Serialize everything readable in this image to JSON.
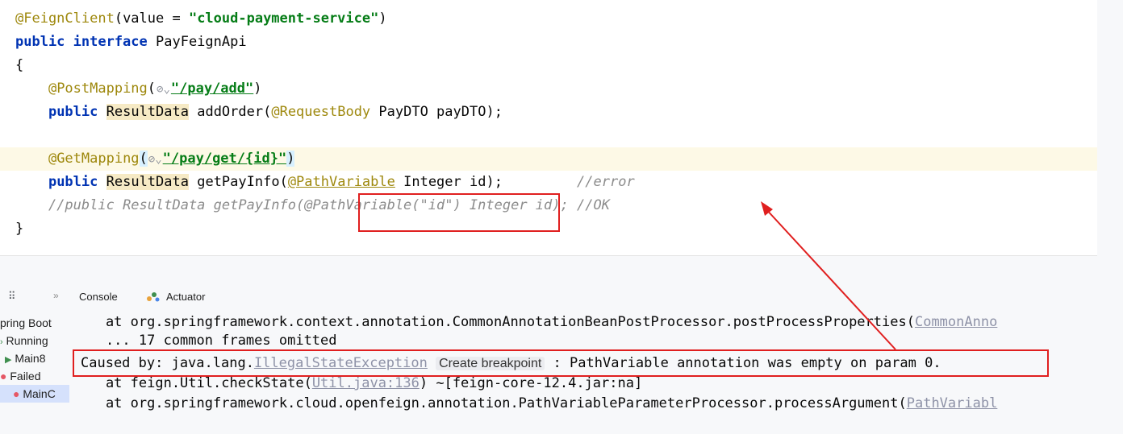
{
  "code": {
    "line1": {
      "ann": "@FeignClient",
      "open": "(value = ",
      "str": "\"cloud-payment-service\"",
      "close": ")"
    },
    "line2": {
      "kw": "public interface",
      "rest": " PayFeignApi"
    },
    "line3": {
      "text": "{"
    },
    "line4": {
      "ann": "@PostMapping",
      "open": "(",
      "inlay": "⊘⌄",
      "str": "\"/pay/add\"",
      "close": ")"
    },
    "line5": {
      "kw": "public",
      "type": "ResultData",
      "mid": " addOrder(",
      "ann": "@RequestBody",
      "rest": " PayDTO payDTO);"
    },
    "line7": {
      "ann": "@GetMapping",
      "open": "(",
      "inlay": "⊘⌄",
      "str": "\"/pay/get/{id}\"",
      "close": ")"
    },
    "line8": {
      "kw": "public",
      "type": "ResultData",
      "mid": " getPayInfo(",
      "ann": "@PathVariable",
      "rest": " Integer id);         ",
      "comment": "//error"
    },
    "line9": {
      "comment": "//public ResultData getPayInfo(@PathVariable(\"id\") Integer id); //OK"
    },
    "line10": {
      "text": "}"
    }
  },
  "toolwindow": {
    "grip_icon": "⠿",
    "more_icon": "»",
    "tab_console": "Console",
    "tab_actuator": "Actuator"
  },
  "run_tree": [
    {
      "icon": "",
      "label": "pring Boot"
    },
    {
      "icon": "›",
      "label": " Running"
    },
    {
      "icon": "▶",
      "label": " Main8"
    },
    {
      "icon": "●",
      "label": " Failed"
    },
    {
      "icon": "●",
      "label": " MainC"
    }
  ],
  "console": {
    "line1": "    at org.springframework.context.annotation.CommonAnnotationBeanPostProcessor.postProcessProperties(",
    "line1_link": "CommonAnno",
    "line2": "    ... 17 common frames omitted",
    "line3_a": "Caused by: java.lang.",
    "line3_link": "IllegalStateException",
    "line3_chip": "Create breakpoint",
    "line3_b": " : PathVariable annotation was empty on param 0.",
    "line4_a": "    at feign.Util.checkState(",
    "line4_link": "Util.java:136",
    "line4_b": ") ~[feign-core-12.4.jar:na]",
    "line5_a": "    at org.springframework.cloud.openfeign.annotation.PathVariableParameterProcessor.processArgument(",
    "line5_link": "PathVariabl"
  },
  "colors": {
    "annotation_box": "#e01f1f",
    "keyword": "#0033b3",
    "string": "#067d17",
    "annotation": "#9e880d",
    "comment": "#8c8c8c"
  }
}
